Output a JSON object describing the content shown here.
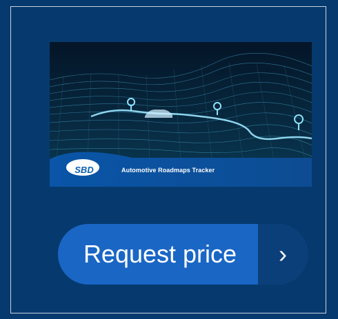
{
  "banner": {
    "logo_text": "SBD",
    "title": "Automotive Roadmaps Tracker"
  },
  "cta": {
    "label": "Request price",
    "arrow": "›"
  },
  "colors": {
    "page_bg": "#063a6e",
    "button_blue": "#1a66c5",
    "button_dark": "#0b3f7a",
    "banner_glow": "#6fd6ff"
  },
  "icons": [
    "map-pin-icon",
    "chevron-right-icon"
  ]
}
